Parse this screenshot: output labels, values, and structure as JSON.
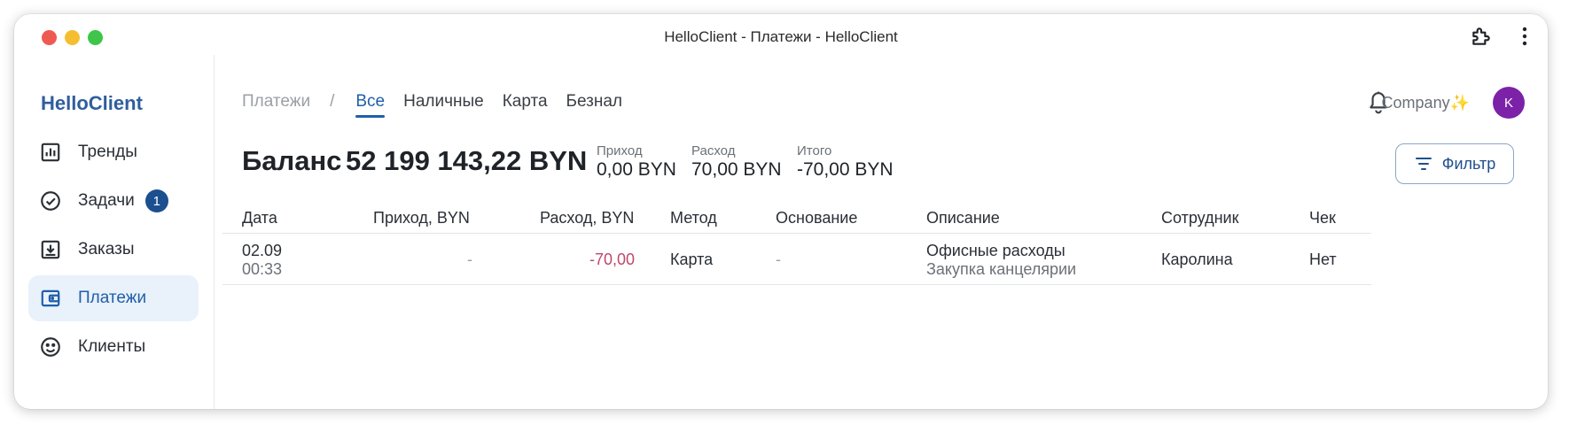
{
  "window": {
    "title": "HelloClient - Платежи - HelloClient"
  },
  "sidebar": {
    "brand": "HelloClient",
    "items": [
      {
        "label": "Тренды",
        "icon": "chart-icon"
      },
      {
        "label": "Задачи",
        "icon": "check-circle-icon",
        "badge": "1"
      },
      {
        "label": "Заказы",
        "icon": "download-box-icon"
      },
      {
        "label": "Платежи",
        "icon": "wallet-icon",
        "active": true
      },
      {
        "label": "Клиенты",
        "icon": "smiley-icon"
      }
    ]
  },
  "header": {
    "breadcrumb": "Платежи",
    "separator": "/",
    "tabs": [
      {
        "label": "Все",
        "active": true
      },
      {
        "label": "Наличные"
      },
      {
        "label": "Карта"
      },
      {
        "label": "Безнал"
      }
    ],
    "company": "Company✨",
    "avatar_initial": "K"
  },
  "summary": {
    "balance_label": "Баланс",
    "balance_value": "52 199 143,22 BYN",
    "income_label": "Приход",
    "income_value": "0,00 BYN",
    "expense_label": "Расход",
    "expense_value": "70,00 BYN",
    "total_label": "Итого",
    "total_value": "-70,00 BYN",
    "filter_label": "Фильтр"
  },
  "table": {
    "columns": [
      "Дата",
      "Приход, BYN",
      "Расход, BYN",
      "Метод",
      "Основание",
      "Описание",
      "Сотрудник",
      "Чек"
    ],
    "rows": [
      {
        "date": "02.09",
        "time": "00:33",
        "income": "-",
        "expense": "-70,00",
        "method": "Карта",
        "basis": "-",
        "description": "Офисные расходы",
        "description_sub": "Закупка канцелярии",
        "employee": "Каролина",
        "receipt": "Нет"
      }
    ]
  },
  "colors": {
    "accent": "#1f5fa8",
    "brand": "#2f5e9e",
    "negative": "#c0476b",
    "avatar": "#7b22a8",
    "active_bg": "#e9f1fb"
  }
}
